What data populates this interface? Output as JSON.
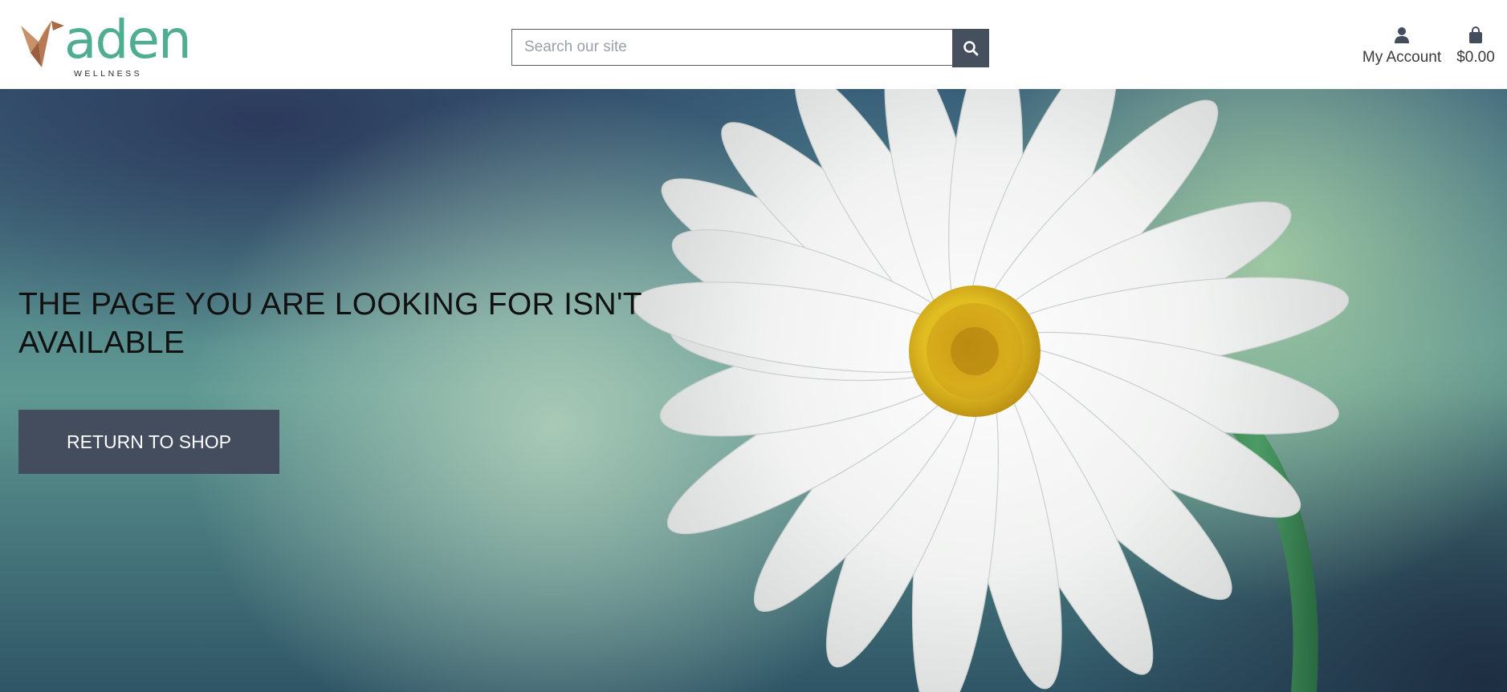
{
  "header": {
    "logo": {
      "word": "aden",
      "subtitle": "WELLNESS",
      "icon": "origami-bird-icon"
    },
    "search": {
      "placeholder": "Search our site",
      "value": "",
      "button_icon": "search-icon"
    },
    "account": {
      "label": "My Account",
      "icon": "user-icon"
    },
    "cart": {
      "label": "$0.00",
      "icon": "shopping-bag-icon"
    }
  },
  "hero": {
    "headline": "THE PAGE YOU ARE LOOKING FOR ISN'T AVAILABLE",
    "button_label": "RETURN TO SHOP",
    "image": "daisy-flower"
  },
  "colors": {
    "brand_green": "#4fae91",
    "logo_copper": "#b87a55",
    "button_dark": "#434d5d",
    "search_button": "#454f5e"
  }
}
